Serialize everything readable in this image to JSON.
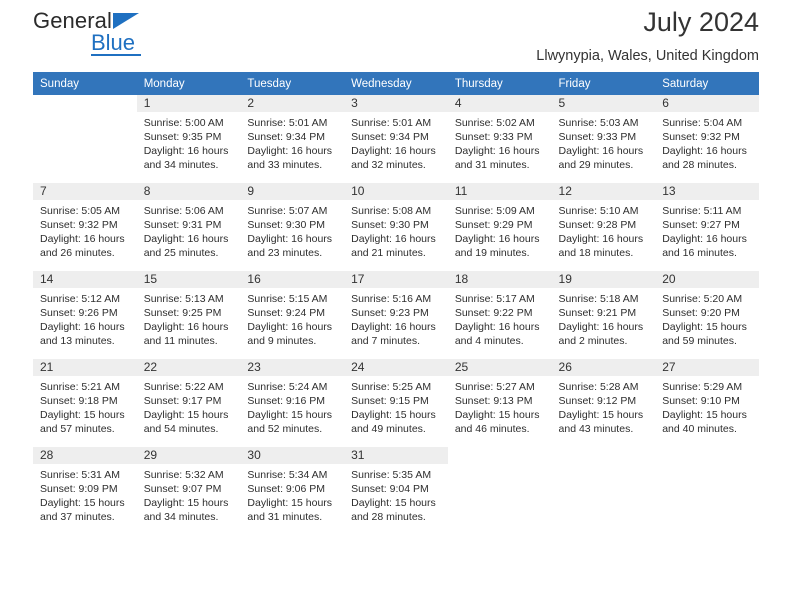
{
  "brand": {
    "name_top": "General",
    "name_bottom": "Blue",
    "accent_color": "#1f70c1"
  },
  "header": {
    "title": "July 2024",
    "location": "Llwynypia, Wales, United Kingdom"
  },
  "theme": {
    "header_bg": "#3275bb",
    "daynum_bg": "#f1f1f1",
    "row_shade": "#f3f3f3"
  },
  "weekdays": [
    "Sunday",
    "Monday",
    "Tuesday",
    "Wednesday",
    "Thursday",
    "Friday",
    "Saturday"
  ],
  "weeks": [
    [
      {
        "day": "",
        "lines": []
      },
      {
        "day": "1",
        "lines": [
          "Sunrise: 5:00 AM",
          "Sunset: 9:35 PM",
          "Daylight: 16 hours",
          "and 34 minutes."
        ]
      },
      {
        "day": "2",
        "lines": [
          "Sunrise: 5:01 AM",
          "Sunset: 9:34 PM",
          "Daylight: 16 hours",
          "and 33 minutes."
        ]
      },
      {
        "day": "3",
        "lines": [
          "Sunrise: 5:01 AM",
          "Sunset: 9:34 PM",
          "Daylight: 16 hours",
          "and 32 minutes."
        ]
      },
      {
        "day": "4",
        "lines": [
          "Sunrise: 5:02 AM",
          "Sunset: 9:33 PM",
          "Daylight: 16 hours",
          "and 31 minutes."
        ]
      },
      {
        "day": "5",
        "lines": [
          "Sunrise: 5:03 AM",
          "Sunset: 9:33 PM",
          "Daylight: 16 hours",
          "and 29 minutes."
        ]
      },
      {
        "day": "6",
        "lines": [
          "Sunrise: 5:04 AM",
          "Sunset: 9:32 PM",
          "Daylight: 16 hours",
          "and 28 minutes."
        ]
      }
    ],
    [
      {
        "day": "7",
        "lines": [
          "Sunrise: 5:05 AM",
          "Sunset: 9:32 PM",
          "Daylight: 16 hours",
          "and 26 minutes."
        ]
      },
      {
        "day": "8",
        "lines": [
          "Sunrise: 5:06 AM",
          "Sunset: 9:31 PM",
          "Daylight: 16 hours",
          "and 25 minutes."
        ]
      },
      {
        "day": "9",
        "lines": [
          "Sunrise: 5:07 AM",
          "Sunset: 9:30 PM",
          "Daylight: 16 hours",
          "and 23 minutes."
        ]
      },
      {
        "day": "10",
        "lines": [
          "Sunrise: 5:08 AM",
          "Sunset: 9:30 PM",
          "Daylight: 16 hours",
          "and 21 minutes."
        ]
      },
      {
        "day": "11",
        "lines": [
          "Sunrise: 5:09 AM",
          "Sunset: 9:29 PM",
          "Daylight: 16 hours",
          "and 19 minutes."
        ]
      },
      {
        "day": "12",
        "lines": [
          "Sunrise: 5:10 AM",
          "Sunset: 9:28 PM",
          "Daylight: 16 hours",
          "and 18 minutes."
        ]
      },
      {
        "day": "13",
        "lines": [
          "Sunrise: 5:11 AM",
          "Sunset: 9:27 PM",
          "Daylight: 16 hours",
          "and 16 minutes."
        ]
      }
    ],
    [
      {
        "day": "14",
        "lines": [
          "Sunrise: 5:12 AM",
          "Sunset: 9:26 PM",
          "Daylight: 16 hours",
          "and 13 minutes."
        ]
      },
      {
        "day": "15",
        "lines": [
          "Sunrise: 5:13 AM",
          "Sunset: 9:25 PM",
          "Daylight: 16 hours",
          "and 11 minutes."
        ]
      },
      {
        "day": "16",
        "lines": [
          "Sunrise: 5:15 AM",
          "Sunset: 9:24 PM",
          "Daylight: 16 hours",
          "and 9 minutes."
        ]
      },
      {
        "day": "17",
        "lines": [
          "Sunrise: 5:16 AM",
          "Sunset: 9:23 PM",
          "Daylight: 16 hours",
          "and 7 minutes."
        ]
      },
      {
        "day": "18",
        "lines": [
          "Sunrise: 5:17 AM",
          "Sunset: 9:22 PM",
          "Daylight: 16 hours",
          "and 4 minutes."
        ]
      },
      {
        "day": "19",
        "lines": [
          "Sunrise: 5:18 AM",
          "Sunset: 9:21 PM",
          "Daylight: 16 hours",
          "and 2 minutes."
        ]
      },
      {
        "day": "20",
        "lines": [
          "Sunrise: 5:20 AM",
          "Sunset: 9:20 PM",
          "Daylight: 15 hours",
          "and 59 minutes."
        ]
      }
    ],
    [
      {
        "day": "21",
        "lines": [
          "Sunrise: 5:21 AM",
          "Sunset: 9:18 PM",
          "Daylight: 15 hours",
          "and 57 minutes."
        ]
      },
      {
        "day": "22",
        "lines": [
          "Sunrise: 5:22 AM",
          "Sunset: 9:17 PM",
          "Daylight: 15 hours",
          "and 54 minutes."
        ]
      },
      {
        "day": "23",
        "lines": [
          "Sunrise: 5:24 AM",
          "Sunset: 9:16 PM",
          "Daylight: 15 hours",
          "and 52 minutes."
        ]
      },
      {
        "day": "24",
        "lines": [
          "Sunrise: 5:25 AM",
          "Sunset: 9:15 PM",
          "Daylight: 15 hours",
          "and 49 minutes."
        ]
      },
      {
        "day": "25",
        "lines": [
          "Sunrise: 5:27 AM",
          "Sunset: 9:13 PM",
          "Daylight: 15 hours",
          "and 46 minutes."
        ]
      },
      {
        "day": "26",
        "lines": [
          "Sunrise: 5:28 AM",
          "Sunset: 9:12 PM",
          "Daylight: 15 hours",
          "and 43 minutes."
        ]
      },
      {
        "day": "27",
        "lines": [
          "Sunrise: 5:29 AM",
          "Sunset: 9:10 PM",
          "Daylight: 15 hours",
          "and 40 minutes."
        ]
      }
    ],
    [
      {
        "day": "28",
        "lines": [
          "Sunrise: 5:31 AM",
          "Sunset: 9:09 PM",
          "Daylight: 15 hours",
          "and 37 minutes."
        ]
      },
      {
        "day": "29",
        "lines": [
          "Sunrise: 5:32 AM",
          "Sunset: 9:07 PM",
          "Daylight: 15 hours",
          "and 34 minutes."
        ]
      },
      {
        "day": "30",
        "lines": [
          "Sunrise: 5:34 AM",
          "Sunset: 9:06 PM",
          "Daylight: 15 hours",
          "and 31 minutes."
        ]
      },
      {
        "day": "31",
        "lines": [
          "Sunrise: 5:35 AM",
          "Sunset: 9:04 PM",
          "Daylight: 15 hours",
          "and 28 minutes."
        ]
      },
      {
        "day": "",
        "lines": []
      },
      {
        "day": "",
        "lines": []
      },
      {
        "day": "",
        "lines": []
      }
    ]
  ]
}
